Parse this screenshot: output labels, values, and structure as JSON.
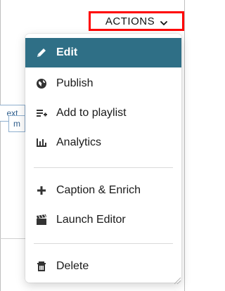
{
  "toolbar": {
    "actions_label": "ACTIONS"
  },
  "background": {
    "chip_1": "ext",
    "chip_2": "m"
  },
  "menu": {
    "items": [
      {
        "label": "Edit",
        "icon": "pencil-icon"
      },
      {
        "label": "Publish",
        "icon": "globe-icon"
      },
      {
        "label": "Add to playlist",
        "icon": "playlist-add-icon"
      },
      {
        "label": "Analytics",
        "icon": "analytics-icon"
      },
      {
        "label": "Caption & Enrich",
        "icon": "plus-icon"
      },
      {
        "label": "Launch Editor",
        "icon": "clapper-icon"
      },
      {
        "label": "Delete",
        "icon": "trash-icon"
      }
    ]
  },
  "colors": {
    "highlight_border": "#ff0000",
    "active_item_bg": "#2f6f86"
  }
}
